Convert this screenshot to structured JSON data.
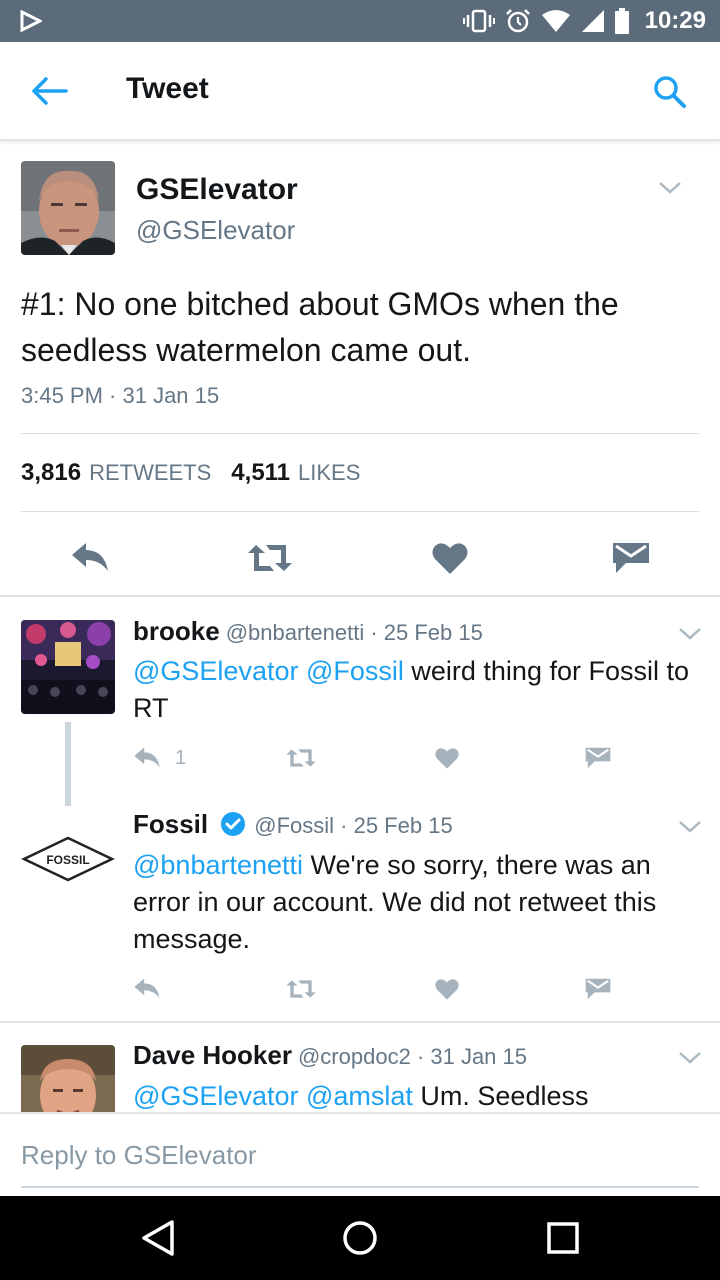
{
  "status_bar": {
    "time": "10:29"
  },
  "app_bar": {
    "title": "Tweet"
  },
  "main_tweet": {
    "name": "GSElevator",
    "handle": "@GSElevator",
    "text": "#1: No one bitched about GMOs when the seedless watermelon came out.",
    "timestamp": "3:45 PM · 31 Jan 15",
    "retweets_count": "3,816",
    "retweets_label": "RETWEETS",
    "likes_count": "4,511",
    "likes_label": "LIKES"
  },
  "replies": [
    {
      "name": "brooke",
      "meta": "@bnbartenetti · 25 Feb 15",
      "mentions": "@GSElevator @Fossil",
      "text": " weird thing for Fossil to RT",
      "reply_count": "1"
    },
    {
      "name": "Fossil",
      "verified": true,
      "meta": "@Fossil · 25 Feb 15",
      "mentions": "@bnbartenetti",
      "text": " We're so sorry, there was an error in our account. We did not retweet this message.",
      "avatar_text": "FOSSIL"
    },
    {
      "name": "Dave Hooker",
      "meta": "@cropdoc2 · 31 Jan 15",
      "mentions": "@GSElevator @amslat",
      "text": " Um. Seedless"
    }
  ],
  "reply_bar": {
    "placeholder": "Reply to GSElevator"
  },
  "colors": {
    "accent": "#1da1f2",
    "status_bar": "#5b6b7a",
    "icon_gray": "#657786",
    "icon_light": "#a6b3bd"
  }
}
